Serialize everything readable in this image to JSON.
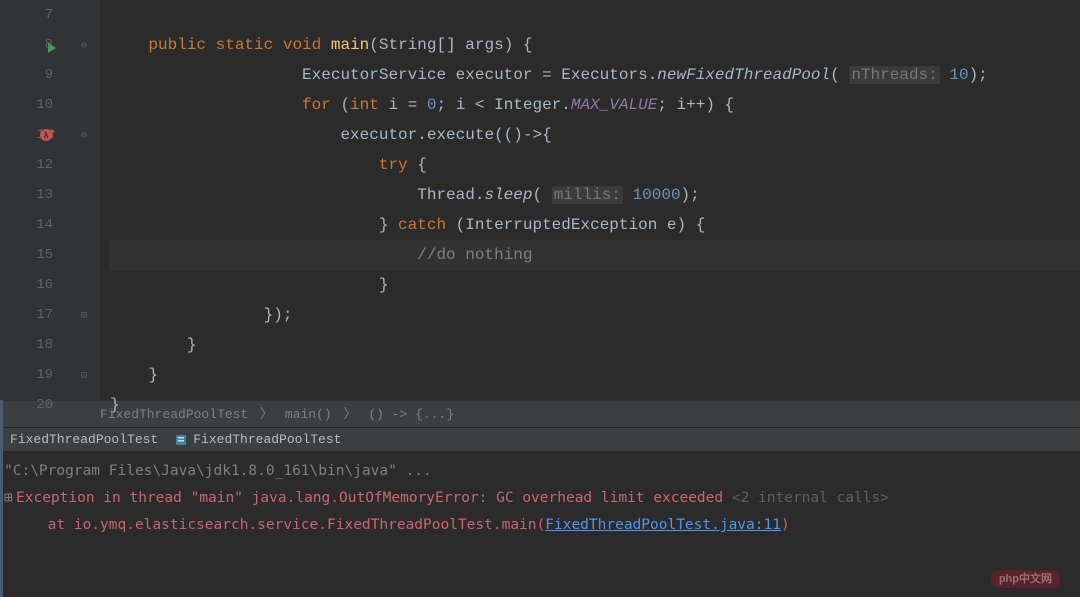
{
  "gutter": {
    "lines": [
      "7",
      "8",
      "9",
      "10",
      "11",
      "12",
      "13",
      "14",
      "15",
      "16",
      "17",
      "18",
      "19",
      "20"
    ]
  },
  "code": {
    "l8": {
      "kw1": "public",
      "kw2": "static",
      "kw3": "void",
      "method": "main",
      "sig": "(String[] args) {"
    },
    "l9": {
      "p1": "ExecutorService executor = Executors.",
      "m": "newFixedThreadPool",
      "hint": "nThreads:",
      "val": "10",
      "end": ");"
    },
    "l10": {
      "kw": "for",
      "p1": " (",
      "kw2": "int",
      "p2": " i = ",
      "n1": "0",
      "p3": "; i < Integer.",
      "sf": "MAX_VALUE",
      "p4": "; i++) {"
    },
    "l11": {
      "p1": "executor.execute(()->{"
    },
    "l12": {
      "kw": "try",
      "p": " {"
    },
    "l13": {
      "p1": "Thread.",
      "m": "sleep",
      "p2": "(",
      "hint": "millis:",
      "val": "10000",
      "end": ");"
    },
    "l14": {
      "p1": "} ",
      "kw": "catch",
      "p2": " (InterruptedException e) {"
    },
    "l15": {
      "c": "//do nothing"
    },
    "l16": {
      "p": "}"
    },
    "l17": {
      "p": "});"
    },
    "l18": {
      "p": "}"
    },
    "l19": {
      "p": "}"
    },
    "l20": {
      "p": "}"
    }
  },
  "breadcrumb": {
    "a": "FixedThreadPoolTest",
    "b": "main()",
    "c": "() -> {...}"
  },
  "tabs": {
    "t1": "FixedThreadPoolTest",
    "t2": "FixedThreadPoolTest"
  },
  "console": {
    "l1": "\"C:\\Program Files\\Java\\jdk1.8.0_161\\bin\\java\" ...",
    "l2a": "Exception in thread \"main\" java.lang.OutOfMemoryError: GC overhead limit exceeded",
    "l2b": " <2 internal calls>",
    "l3a": "     at io.ymq.elasticsearch.service.FixedThreadPoolTest.main(",
    "l3b": "FixedThreadPoolTest.java:11",
    "l3c": ")"
  },
  "watermark": "php中文网"
}
